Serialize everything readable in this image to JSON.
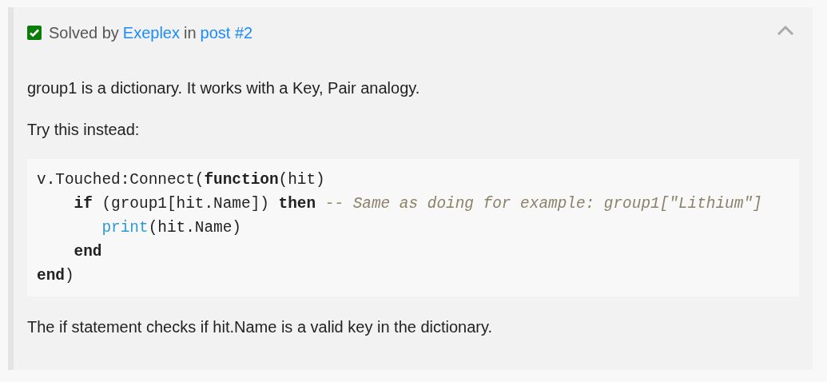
{
  "solution": {
    "checked": true,
    "parts": [
      {
        "kind": "text",
        "text": "Solved by"
      },
      {
        "kind": "link",
        "text": "Exeplex"
      },
      {
        "kind": "text",
        "text": "in"
      },
      {
        "kind": "link",
        "text": "post #2"
      }
    ],
    "expanded": true
  },
  "body": [
    {
      "kind": "paragraph",
      "text": "group1 is a dictionary. It works with a Key, Pair analogy."
    },
    {
      "kind": "paragraph",
      "text": "Try this instead:"
    },
    {
      "kind": "code",
      "lines": [
        [
          {
            "kind": "plain",
            "text": "v.Touched:Connect("
          },
          {
            "kind": "keyword",
            "text": "function"
          },
          {
            "kind": "plain",
            "text": "(hit)"
          }
        ],
        [
          {
            "kind": "keyword",
            "text": "    if"
          },
          {
            "kind": "plain",
            "text": " (group1[hit.Name]) "
          },
          {
            "kind": "keyword",
            "text": "then"
          },
          {
            "kind": "comment",
            "text": " -- Same as doing for example: group1[\"Lithium\"]"
          }
        ],
        [
          {
            "kind": "builtin",
            "text": "       print"
          },
          {
            "kind": "plain",
            "text": "(hit.Name)"
          }
        ],
        [
          {
            "kind": "keyword",
            "text": "    end"
          }
        ],
        [
          {
            "kind": "keyword",
            "text": "end"
          },
          {
            "kind": "plain",
            "text": ")"
          }
        ]
      ]
    },
    {
      "kind": "paragraph",
      "text": "The if statement checks if hit.Name is a valid key in the dictionary."
    }
  ]
}
